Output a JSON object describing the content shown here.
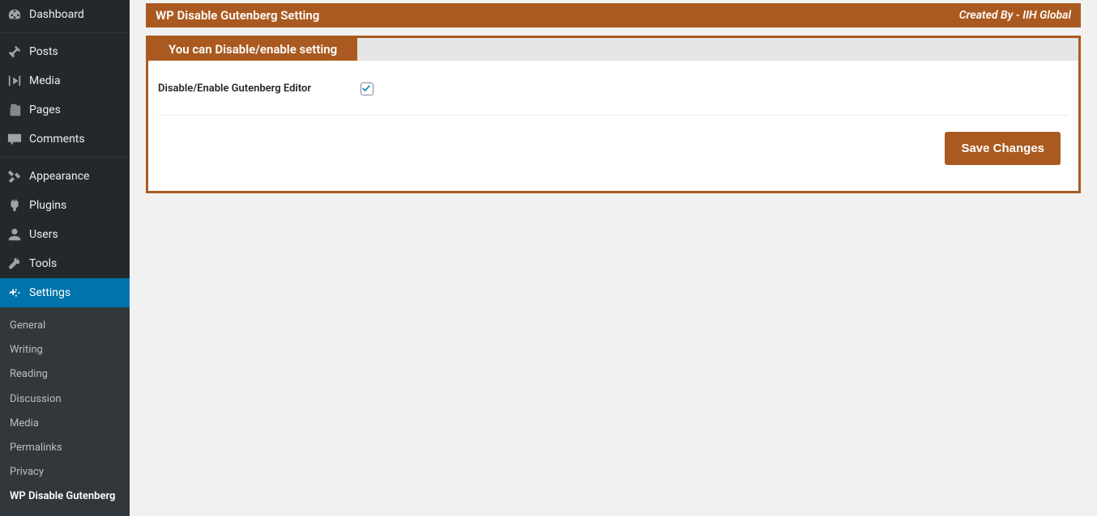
{
  "sidebar": {
    "items": [
      {
        "label": "Dashboard",
        "icon": "dashboard"
      },
      {
        "label": "Posts",
        "icon": "pin"
      },
      {
        "label": "Media",
        "icon": "media"
      },
      {
        "label": "Pages",
        "icon": "pages"
      },
      {
        "label": "Comments",
        "icon": "comments"
      },
      {
        "label": "Appearance",
        "icon": "appearance"
      },
      {
        "label": "Plugins",
        "icon": "plugins"
      },
      {
        "label": "Users",
        "icon": "users"
      },
      {
        "label": "Tools",
        "icon": "tools"
      },
      {
        "label": "Settings",
        "icon": "settings"
      }
    ],
    "submenu": [
      {
        "label": "General"
      },
      {
        "label": "Writing"
      },
      {
        "label": "Reading"
      },
      {
        "label": "Discussion"
      },
      {
        "label": "Media"
      },
      {
        "label": "Permalinks"
      },
      {
        "label": "Privacy"
      },
      {
        "label": "WP Disable Gutenberg"
      }
    ]
  },
  "header": {
    "title": "WP Disable Gutenberg Setting",
    "credit": "Created By - IIH Global"
  },
  "tab": {
    "label": "You can Disable/enable setting"
  },
  "form": {
    "field_label": "Disable/Enable Gutenberg Editor",
    "save_label": "Save Changes"
  }
}
